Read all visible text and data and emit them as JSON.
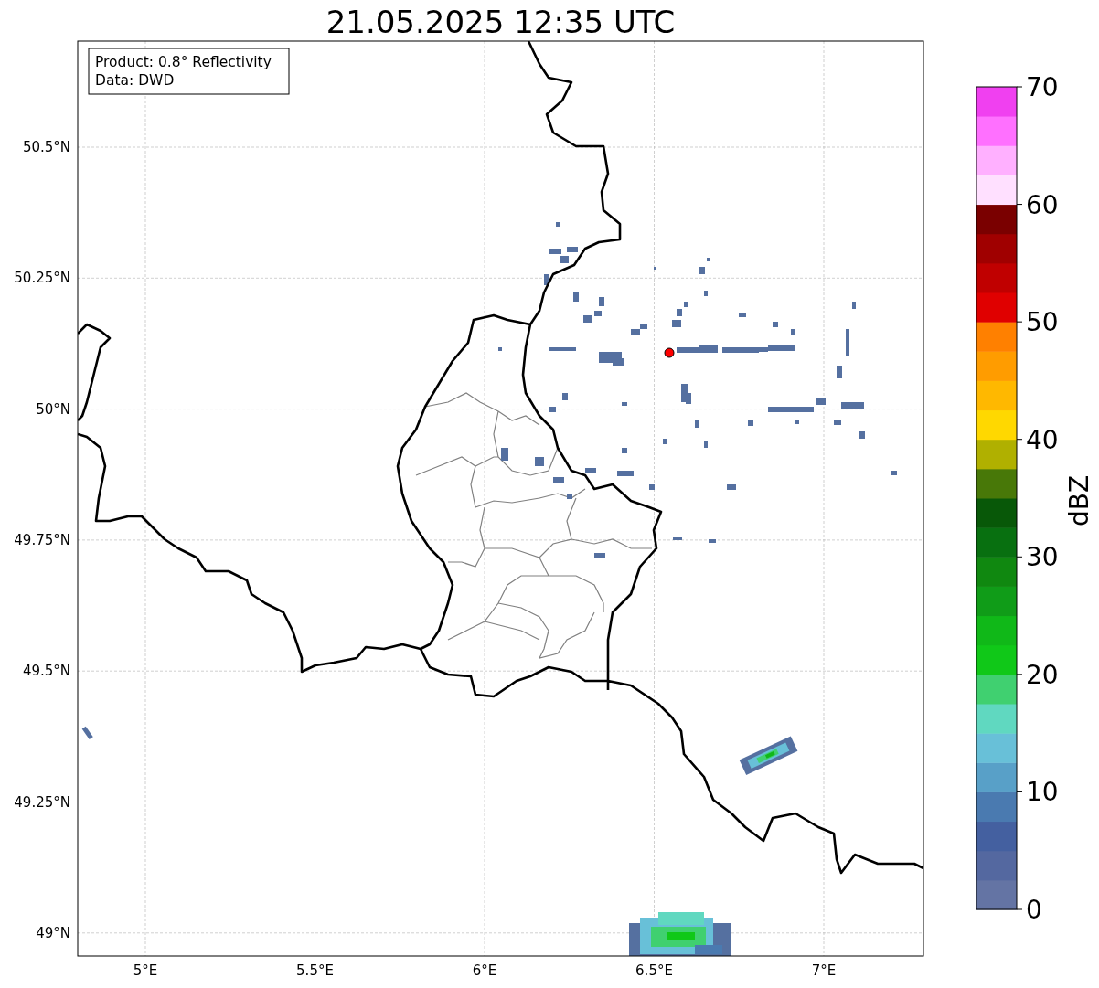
{
  "title": "21.05.2025 12:35 UTC",
  "map": {
    "info_box": [
      "Product: 0.8° Reflectivity",
      "Data: DWD"
    ],
    "lat_ticks": [
      "50.5°N",
      "50.25°N",
      "50°N",
      "49.75°N",
      "49.5°N",
      "49.25°N",
      "49°N"
    ],
    "lon_ticks": [
      "5°E",
      "5.5°E",
      "6°E",
      "6.5°E",
      "7°E"
    ]
  },
  "colorbar": {
    "label": "dBZ",
    "ticks": [
      "70",
      "60",
      "50",
      "40",
      "30",
      "20",
      "10",
      "0"
    ],
    "bins": [
      {
        "color": "#6474a4"
      },
      {
        "color": "#5468a0"
      },
      {
        "color": "#4460a0"
      },
      {
        "color": "#4a7ab0"
      },
      {
        "color": "#58a0c8"
      },
      {
        "color": "#68c0d8"
      },
      {
        "color": "#60d8c0"
      },
      {
        "color": "#40d070"
      },
      {
        "color": "#10c818"
      },
      {
        "color": "#10b818"
      },
      {
        "color": "#109c18"
      },
      {
        "color": "#108810"
      },
      {
        "color": "#087010"
      },
      {
        "color": "#085808"
      },
      {
        "color": "#487808"
      },
      {
        "color": "#b0b000"
      },
      {
        "color": "#ffd800"
      },
      {
        "color": "#ffb800"
      },
      {
        "color": "#ff9c00"
      },
      {
        "color": "#ff8000"
      },
      {
        "color": "#e00000"
      },
      {
        "color": "#c00000"
      },
      {
        "color": "#a00000"
      },
      {
        "color": "#7a0000"
      },
      {
        "color": "#ffe0ff"
      },
      {
        "color": "#ffb0ff"
      },
      {
        "color": "#ff70ff"
      },
      {
        "color": "#f040f0"
      }
    ]
  }
}
